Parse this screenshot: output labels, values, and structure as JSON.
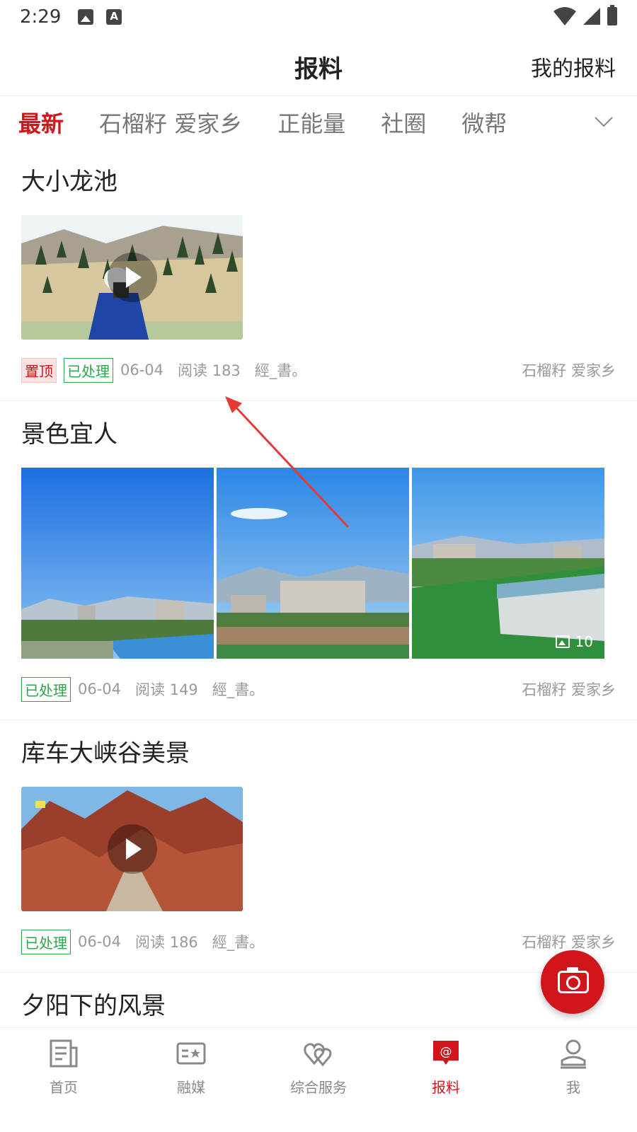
{
  "status": {
    "time": "2:29"
  },
  "header": {
    "title": "报料",
    "my_reports": "我的报料"
  },
  "tabs": [
    {
      "label": "最新",
      "active": true
    },
    {
      "label": "石榴籽 爱家乡",
      "active": false
    },
    {
      "label": "正能量",
      "active": false
    },
    {
      "label": "社圈",
      "active": false
    },
    {
      "label": "微帮",
      "active": false
    }
  ],
  "posts": [
    {
      "title": "大小龙池",
      "media": "video",
      "pinned_label": "置顶",
      "status_label": "已处理",
      "date": "06-04",
      "reads": "阅读 183",
      "author": "經_書。",
      "source": "石榴籽 爱家乡"
    },
    {
      "title": "景色宜人",
      "media": "images",
      "image_count": "10",
      "status_label": "已处理",
      "date": "06-04",
      "reads": "阅读 149",
      "author": "經_書。",
      "source": "石榴籽 爱家乡"
    },
    {
      "title": "库车大峡谷美景",
      "media": "video",
      "status_label": "已处理",
      "date": "06-04",
      "reads": "阅读 186",
      "author": "經_書。",
      "source": "石榴籽 爱家乡"
    },
    {
      "title": "夕阳下的风景"
    }
  ],
  "bottom_nav": [
    {
      "label": "首页",
      "icon": "news-icon",
      "active": false
    },
    {
      "label": "融媒",
      "icon": "media-icon",
      "active": false
    },
    {
      "label": "综合服务",
      "icon": "hearts-icon",
      "active": false
    },
    {
      "label": "报料",
      "icon": "report-icon",
      "active": true
    },
    {
      "label": "我",
      "icon": "profile-icon",
      "active": false
    }
  ],
  "colors": {
    "accent": "#d0161a",
    "done": "#2aa84a",
    "annotation_arrow": "#e53935"
  }
}
